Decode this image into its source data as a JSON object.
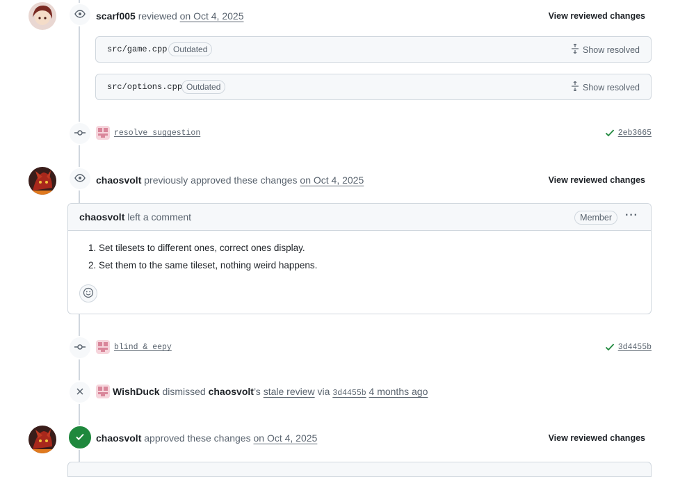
{
  "review1": {
    "user": "scarf005",
    "action": "reviewed",
    "date": "on Oct 4, 2025",
    "view_label": "View reviewed changes",
    "files": [
      {
        "path": "src/game.cpp",
        "status": "Outdated",
        "action": "Show resolved"
      },
      {
        "path": "src/options.cpp",
        "status": "Outdated",
        "action": "Show resolved"
      }
    ]
  },
  "commit1": {
    "message": "resolve suggestion",
    "sha": "2eb3665"
  },
  "review2": {
    "user": "chaosvolt",
    "action": "previously approved these changes",
    "date": "on Oct 4, 2025",
    "view_label": "View reviewed changes"
  },
  "comment": {
    "user": "chaosvolt",
    "action": "left a comment",
    "role": "Member",
    "menu": "···",
    "items": [
      "Set tilesets to different ones, correct ones display.",
      "Set them to the same tileset, nothing weird happens."
    ]
  },
  "commit2": {
    "message": "blind & eepy",
    "sha": "3d4455b"
  },
  "dismissal": {
    "user": "WishDuck",
    "action": "dismissed",
    "target": "chaosvolt",
    "possessive": "’s",
    "link": "stale review",
    "via": "via",
    "sha": "3d4455b",
    "time": "4 months ago"
  },
  "review3": {
    "user": "chaosvolt",
    "action": "approved these changes",
    "date": "on Oct 4, 2025",
    "view_label": "View reviewed changes"
  },
  "colors": {
    "green": "#1f883d",
    "border": "#d0d7de",
    "muted": "#59636e"
  }
}
